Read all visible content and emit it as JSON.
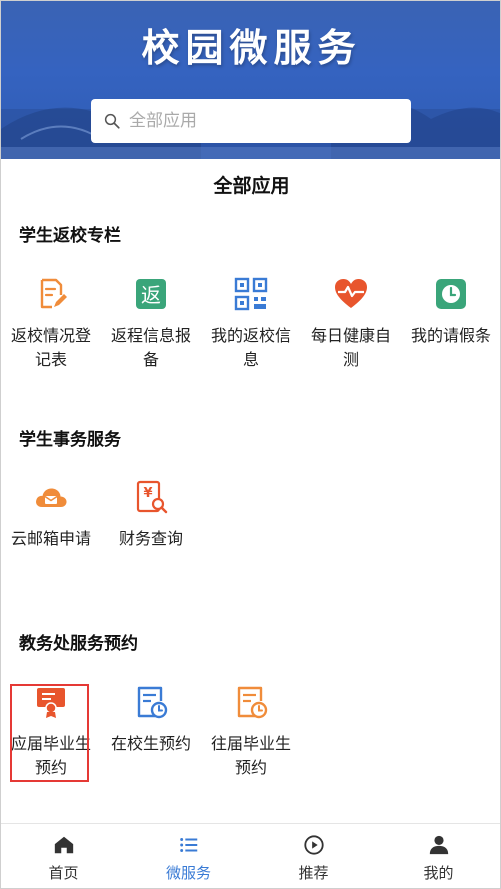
{
  "banner": {
    "title": "校园微服务"
  },
  "search": {
    "placeholder": "全部应用"
  },
  "page_title": "全部应用",
  "sections": [
    {
      "title": "学生返校专栏",
      "items": [
        {
          "label": "返校情况登记表",
          "icon": "edit-form-icon",
          "color": "#f08c3a"
        },
        {
          "label": "返程信息报备",
          "icon": "return-badge-icon",
          "color": "#3aa57a"
        },
        {
          "label": "我的返校信息",
          "icon": "qr-code-icon",
          "color": "#3a7bd5"
        },
        {
          "label": "每日健康自测",
          "icon": "heart-pulse-icon",
          "color": "#e8552d"
        },
        {
          "label": "我的请假条",
          "icon": "clock-badge-icon",
          "color": "#3aa57a"
        }
      ]
    },
    {
      "title": "学生事务服务",
      "items": [
        {
          "label": "云邮箱申请",
          "icon": "cloud-mail-icon",
          "color": "#f08c3a"
        },
        {
          "label": "财务查询",
          "icon": "finance-search-icon",
          "color": "#e8552d"
        }
      ]
    },
    {
      "title": "教务处服务预约",
      "items": [
        {
          "label": "应届毕业生预约",
          "icon": "certificate-icon",
          "color": "#e8552d"
        },
        {
          "label": "在校生预约",
          "icon": "document-clock-icon",
          "color": "#3a7bd5"
        },
        {
          "label": "往届毕业生预约",
          "icon": "document-clock-orange-icon",
          "color": "#f08c3a"
        }
      ]
    }
  ],
  "tabs": [
    {
      "label": "首页",
      "icon": "home-icon",
      "active": false
    },
    {
      "label": "微服务",
      "icon": "list-icon",
      "active": true
    },
    {
      "label": "推荐",
      "icon": "play-circle-icon",
      "active": false
    },
    {
      "label": "我的",
      "icon": "user-icon",
      "active": false
    }
  ],
  "colors": {
    "accent": "#3a7bd5",
    "banner": "#3563c0",
    "highlight": "#e53935"
  }
}
